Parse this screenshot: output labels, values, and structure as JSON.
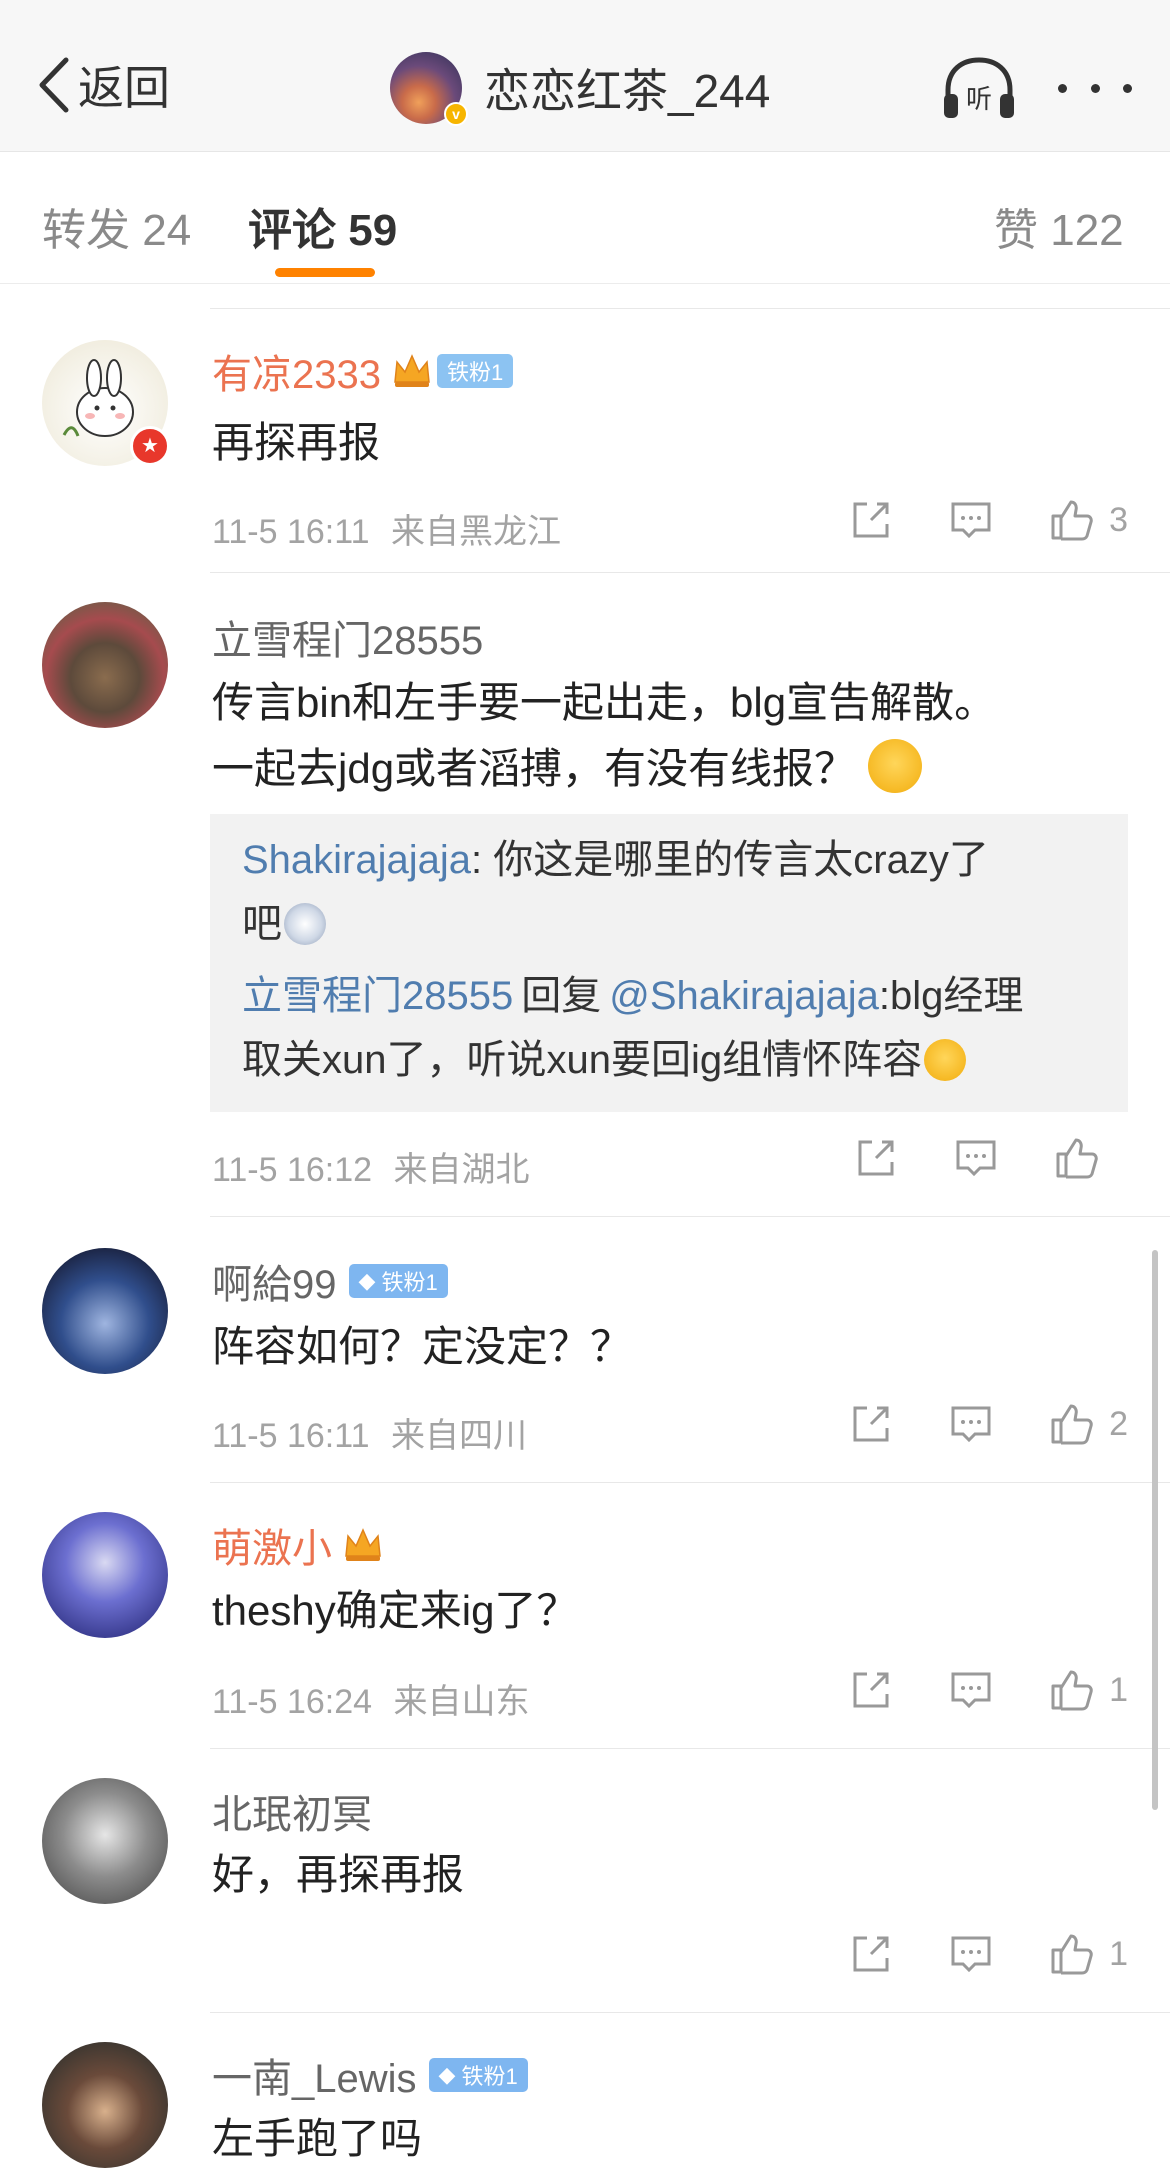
{
  "header": {
    "back_label": "返回",
    "title": "恋恋红茶_244",
    "verified_mark": "v",
    "listen_icon": "headphones-listen-icon",
    "more_icon": "more-dots-icon"
  },
  "tabs": [
    {
      "label": "转发 24",
      "active": false
    },
    {
      "label": "评论 59",
      "active": true
    },
    {
      "label": "赞 122",
      "active": false
    }
  ],
  "colors": {
    "accent": "#ff8200",
    "vip_name": "#eb7350",
    "reply_user": "#507daf",
    "fan_badge": "#8cc3f2"
  },
  "comments": [
    {
      "name": "有凉2333",
      "vip": true,
      "crown": true,
      "badge": "铁粉1",
      "text": "再探再报",
      "time": "11-5 16:11",
      "location": "来自黑龙江",
      "likes": "3"
    },
    {
      "name": "立雪程门28555",
      "vip": false,
      "text_line1": "传言bin和左手要一起出走，blg宣告解散。",
      "text_line2": "一起去jdg或者滔搏，有没有线报？",
      "replies": [
        {
          "user": "Shakirajajaja",
          "text_a": ": 你这是哪里的传言太crazy了",
          "text_b": "吧"
        },
        {
          "user": "立雪程门28555",
          "reply_word": "回复",
          "target": "@Shakirajajaja",
          "text_a": ":blg经理",
          "text_b": "取关xun了，听说xun要回ig组情怀阵容"
        }
      ],
      "time": "11-5 16:12",
      "location": "来自湖北",
      "likes": ""
    },
    {
      "name": "啊給99",
      "vip": false,
      "badge": "铁粉1",
      "text": "阵容如何？定没定？？",
      "time": "11-5 16:11",
      "location": "来自四川",
      "likes": "2"
    },
    {
      "name": "萌激小",
      "vip": true,
      "crown": true,
      "text": "theshy确定来ig了？",
      "time": "11-5 16:24",
      "location": "来自山东",
      "likes": "1"
    },
    {
      "name": "北珉初冥",
      "vip": false,
      "text": "好，再探再报",
      "time": "",
      "location": "",
      "likes": "1"
    },
    {
      "name": "一南_Lewis",
      "vip": false,
      "badge": "铁粉1",
      "text": "左手跑了吗"
    }
  ],
  "action_icons": [
    "share-icon",
    "comment-icon",
    "like-icon"
  ]
}
